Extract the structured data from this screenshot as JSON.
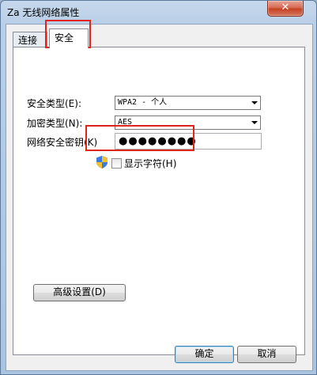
{
  "window": {
    "title": "Za 无线网络属性",
    "close_symbol": "✕"
  },
  "tabs": [
    {
      "label": "连接"
    },
    {
      "label": "安全"
    }
  ],
  "security": {
    "type_label": "安全类型(E):",
    "type_value": "WPA2 - 个人",
    "encryption_label": "加密类型(N):",
    "encryption_value": "AES",
    "key_label": "网络安全密钥(K)",
    "key_value": "●●●●●●●●",
    "show_chars_label": "显示字符(H)",
    "show_chars_checked": false
  },
  "buttons": {
    "advanced": "高级设置(D)",
    "ok": "确定",
    "cancel": "取消"
  },
  "colors": {
    "highlight": "#e0231b",
    "close_button": "#c4401f"
  }
}
